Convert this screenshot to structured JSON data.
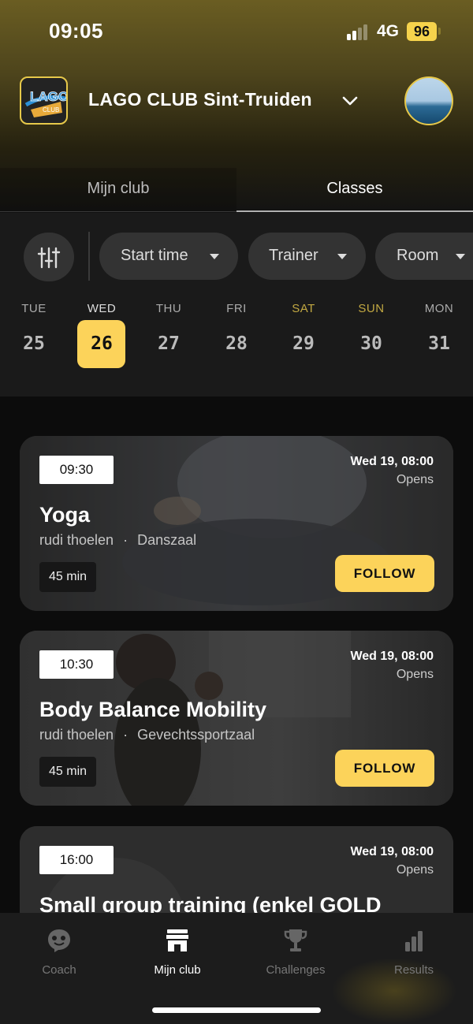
{
  "status_bar": {
    "time": "09:05",
    "network": "4G",
    "battery": "96"
  },
  "header": {
    "club_name": "LAGO CLUB Sint-Truiden",
    "logo_text": "LAGO",
    "logo_subtext": "CLUB"
  },
  "tabs": [
    {
      "label": "Mijn club",
      "active": false
    },
    {
      "label": "Classes",
      "active": true
    }
  ],
  "filters": {
    "chips": [
      {
        "label": "Start time"
      },
      {
        "label": "Trainer"
      },
      {
        "label": "Room"
      }
    ]
  },
  "days": [
    {
      "name": "TUE",
      "num": "25",
      "weekend": false,
      "selected": false
    },
    {
      "name": "WED",
      "num": "26",
      "weekend": false,
      "selected": true
    },
    {
      "name": "THU",
      "num": "27",
      "weekend": false,
      "selected": false
    },
    {
      "name": "FRI",
      "num": "28",
      "weekend": false,
      "selected": false
    },
    {
      "name": "SAT",
      "num": "29",
      "weekend": true,
      "selected": false
    },
    {
      "name": "SUN",
      "num": "30",
      "weekend": true,
      "selected": false
    },
    {
      "name": "MON",
      "num": "31",
      "weekend": false,
      "selected": false
    }
  ],
  "classes": [
    {
      "time": "09:30",
      "opens_date": "Wed 19, 08:00",
      "opens_label": "Opens",
      "title": "Yoga",
      "trainer": "rudi thoelen",
      "separator": "·",
      "room": "Danszaal",
      "duration": "45 min",
      "button": "FOLLOW"
    },
    {
      "time": "10:30",
      "opens_date": "Wed 19, 08:00",
      "opens_label": "Opens",
      "title": "Body Balance Mobility",
      "trainer": "rudi thoelen",
      "separator": "·",
      "room": "Gevechtssportzaal",
      "duration": "45 min",
      "button": "FOLLOW"
    },
    {
      "time": "16:00",
      "opens_date": "Wed 19, 08:00",
      "opens_label": "Opens",
      "title": "Small group training (enkel GOLD"
    }
  ],
  "bottom_nav": [
    {
      "label": "Coach",
      "icon": "coach-icon",
      "active": false
    },
    {
      "label": "Mijn club",
      "icon": "store-icon",
      "active": true
    },
    {
      "label": "Challenges",
      "icon": "trophy-icon",
      "active": false
    },
    {
      "label": "Results",
      "icon": "bar-chart-icon",
      "active": false
    }
  ],
  "colors": {
    "accent": "#fcd35a",
    "background": "#0c0c0c",
    "card": "#2d2d2d",
    "header_gold": "#6a5d22"
  }
}
